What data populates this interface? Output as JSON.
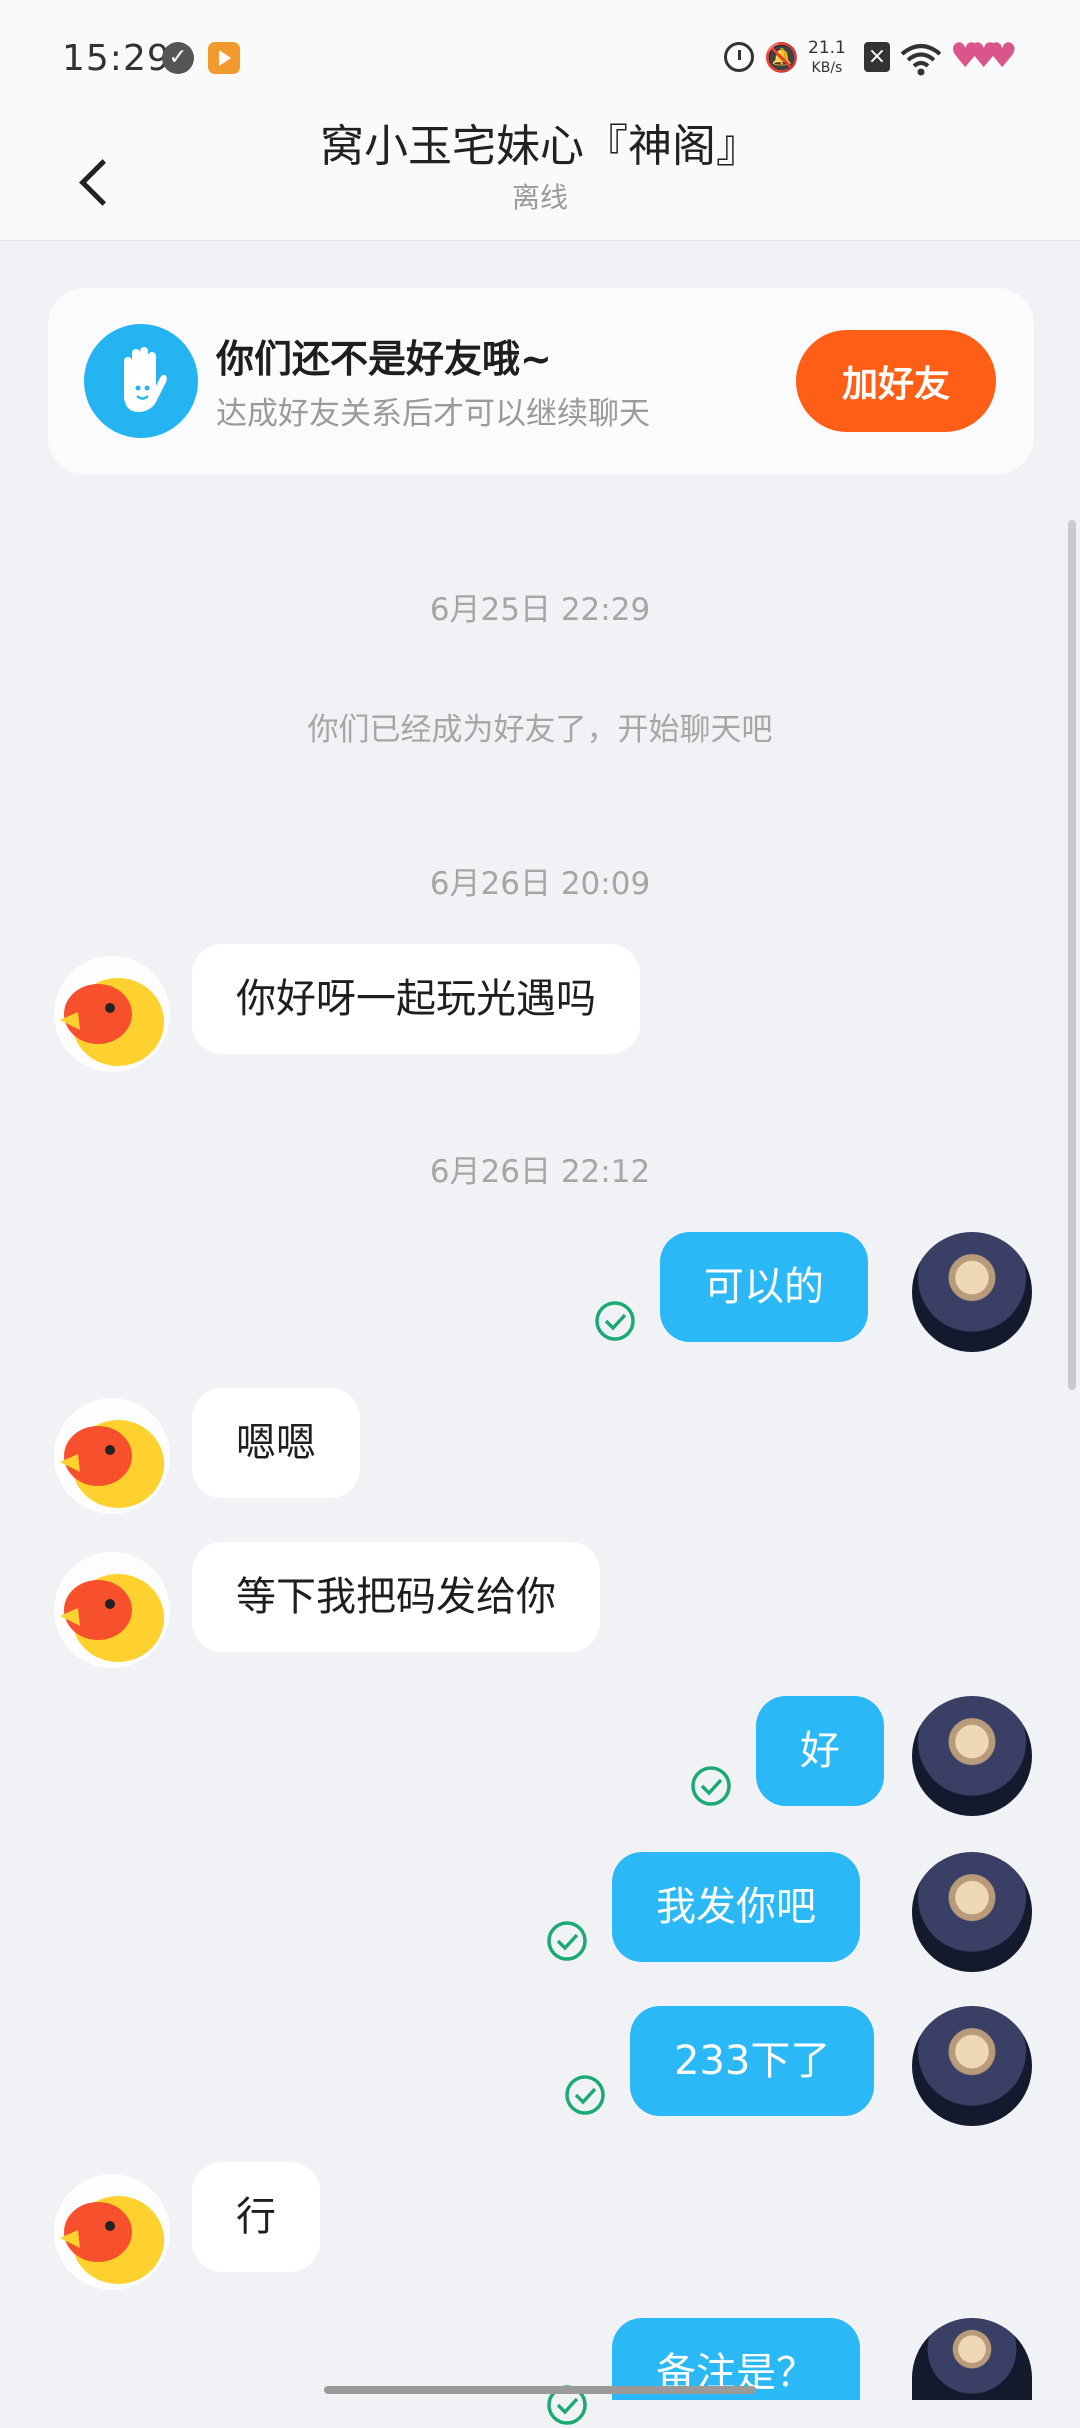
{
  "status_bar": {
    "time": "15:29",
    "net_speed_value": "21.1",
    "net_speed_unit": "KB/s",
    "icons": [
      "check-circle-icon",
      "video-app-icon",
      "alarm-icon",
      "mute-bell-icon",
      "no-sim-icon",
      "wifi-icon",
      "battery-hearts-icon"
    ]
  },
  "header": {
    "title": "窝小玉宅妹心『神阁』",
    "status": "离线",
    "back_icon": "chevron-left-icon"
  },
  "friend_banner": {
    "title": "你们还不是好友哦~",
    "subtitle": "达成好友关系后才可以继续聊天",
    "button_label": "加好友",
    "icon": "hand-wave-icon",
    "accent": "#FF5E16",
    "icon_bg": "#25B4F2"
  },
  "chat": {
    "timestamps": [
      "6月25日 22:29",
      "6月26日 20:09",
      "6月26日 22:12"
    ],
    "system_message": "你们已经成为好友了，开始聊天吧",
    "messages": [
      {
        "from": "them",
        "text": "你好呀一起玩光遇吗"
      },
      {
        "from": "me",
        "text": "可以的",
        "read": true
      },
      {
        "from": "them",
        "text": "嗯嗯"
      },
      {
        "from": "them",
        "text": "等下我把码发给你"
      },
      {
        "from": "me",
        "text": "好",
        "read": true
      },
      {
        "from": "me",
        "text": "我发你吧",
        "read": true
      },
      {
        "from": "me",
        "text": "233下了",
        "read": true
      },
      {
        "from": "them",
        "text": "行"
      },
      {
        "from": "me",
        "text": "备注是？",
        "read": true
      }
    ],
    "colors": {
      "outgoing_bubble": "#2AB8F6",
      "incoming_bubble": "#FFFFFF",
      "read_check": "#1BAA73",
      "background": "#F1F2F6"
    }
  }
}
